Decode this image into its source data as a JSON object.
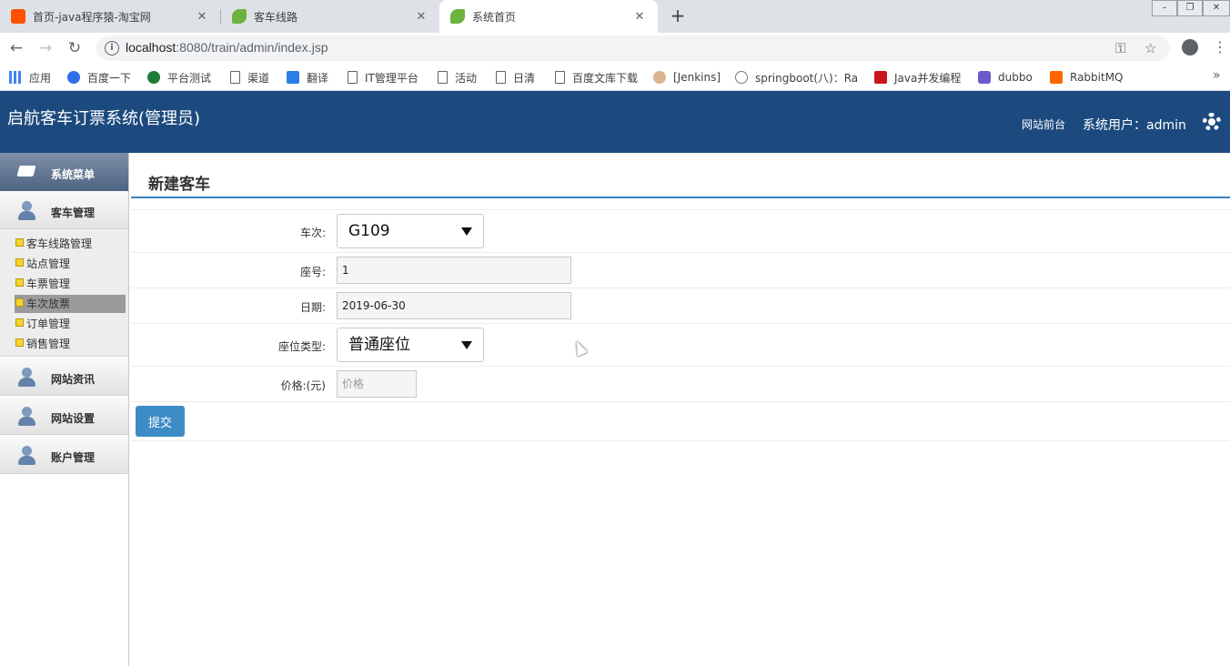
{
  "browser": {
    "tabs": [
      {
        "title": "首页-java程序猿-淘宝网",
        "favicon_color": "#ff5000"
      },
      {
        "title": "客车线路",
        "favicon_color": "#6db33f"
      },
      {
        "title": "系统首页",
        "favicon_color": "#6db33f"
      }
    ],
    "close_glyph": "✕",
    "newtab_glyph": "+",
    "url_host": "localhost",
    "url_rest": ":8080/train/admin/index.jsp",
    "bookmarks": [
      {
        "label": "应用",
        "icon": "apps-icon"
      },
      {
        "label": "百度一下",
        "icon": "baidu-icon"
      },
      {
        "label": "平台测试",
        "icon": "globe-icon"
      },
      {
        "label": "渠道",
        "icon": "page-icon"
      },
      {
        "label": "翻译",
        "icon": "translate-icon"
      },
      {
        "label": "IT管理平台",
        "icon": "page-icon"
      },
      {
        "label": "活动",
        "icon": "page-icon"
      },
      {
        "label": "日清",
        "icon": "page-icon"
      },
      {
        "label": "百度文库下载",
        "icon": "page-icon"
      },
      {
        "label": "[Jenkins]",
        "icon": "jenkins-icon"
      },
      {
        "label": "springboot(八)：Ra",
        "icon": "globe-icon"
      },
      {
        "label": "Java并发编程",
        "icon": "csdn-icon"
      },
      {
        "label": "dubbo",
        "icon": "dubbo-icon"
      },
      {
        "label": "RabbitMQ",
        "icon": "rabbitmq-icon"
      }
    ],
    "bookmarks_more": "»"
  },
  "header": {
    "title": "启航客车订票系统(管理员)",
    "front_link": "网站前台",
    "user_label": "系统用户：admin"
  },
  "sidebar": {
    "menu_title": "系统菜单",
    "groups": [
      {
        "label": "客车管理"
      },
      {
        "label": "网站资讯"
      },
      {
        "label": "网站设置"
      },
      {
        "label": "账户管理"
      }
    ],
    "sub_items": [
      {
        "label": "客车线路管理"
      },
      {
        "label": "站点管理"
      },
      {
        "label": "车票管理"
      },
      {
        "label": "车次放票"
      },
      {
        "label": "订单管理"
      },
      {
        "label": "销售管理"
      }
    ]
  },
  "form": {
    "title": "新建客车",
    "train_label": "车次:",
    "train_value": "G109",
    "seat_label": "座号:",
    "seat_value": "1",
    "date_label": "日期:",
    "date_value": "2019-06-30",
    "seat_type_label": "座位类型:",
    "seat_type_value": "普通座位",
    "price_label": "价格:(元)",
    "price_placeholder": "价格",
    "submit_label": "提交"
  }
}
